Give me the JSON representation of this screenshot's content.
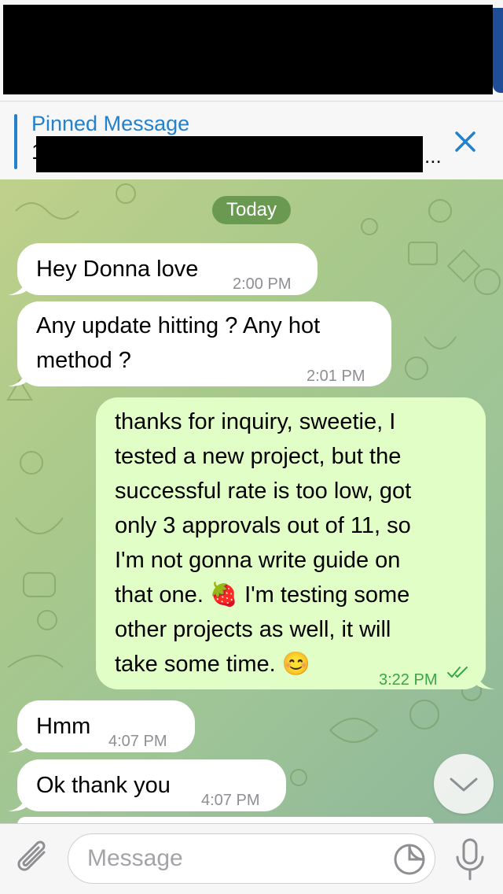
{
  "pinned": {
    "title": "Pinned Message",
    "preview_peek": "1",
    "ellipsis": "..."
  },
  "date_divider": "Today",
  "messages": [
    {
      "direction": "in",
      "lines": [
        "Hey Donna love"
      ],
      "time": "2:00 PM"
    },
    {
      "direction": "in",
      "lines": [
        "Any update hitting ? Any hot",
        "method ?"
      ],
      "time": "2:01 PM"
    },
    {
      "direction": "out",
      "lines": [
        "thanks for inquiry, sweetie, I",
        "tested a new project, but the",
        "successful rate is too low, got",
        "only 3 approvals out of 11, so",
        "I'm not gonna write guide on",
        "that one. 🍓 I'm testing some",
        "other projects as well, it will",
        "take some time. 😊"
      ],
      "time": "3:22 PM",
      "status": "read"
    },
    {
      "direction": "in",
      "lines": [
        "Hmm"
      ],
      "time": "4:07 PM"
    },
    {
      "direction": "in",
      "lines": [
        "Ok thank you"
      ],
      "time": "4:07 PM"
    }
  ],
  "composer": {
    "placeholder": "Message"
  },
  "icons": {
    "close": "close-icon",
    "attach": "paperclip-icon",
    "sticker": "sticker-icon",
    "mic": "microphone-icon",
    "scroll": "chevron-down-icon",
    "read": "double-check-icon"
  },
  "colors": {
    "accent": "#2481cc",
    "outgoing_bubble": "#e1fec6",
    "incoming_bubble": "#ffffff",
    "date_pill": "#6a9a52",
    "outgoing_time": "#3aa546"
  }
}
